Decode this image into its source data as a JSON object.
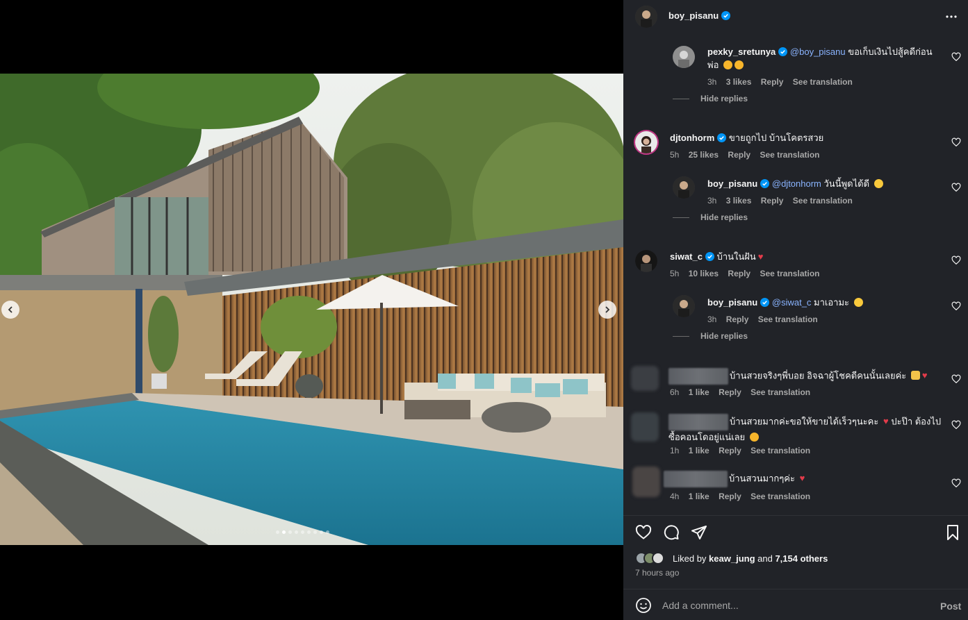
{
  "post": {
    "author": "boy_pisanu",
    "more_icon": "more-horizontal-icon",
    "carousel": {
      "slide_count": 9,
      "active_index": 1
    }
  },
  "comments": [
    {
      "user": "pexky_sretunya",
      "verified": true,
      "mention": "@boy_pisanu",
      "text": " ขอเก็บเงินไปสู้คดีก่อน พ่อ",
      "emoji": [
        "star-eyes",
        "star-eyes"
      ],
      "time": "3h",
      "likes": "3 likes",
      "reply": "Reply",
      "translate": "See translation",
      "hide_replies": "Hide replies"
    },
    {
      "user": "djtonhorm",
      "verified": true,
      "text": " ขายถูกไป บ้านโคตรสวย",
      "time": "5h",
      "likes": "25 likes",
      "reply": "Reply",
      "translate": "See translation"
    },
    {
      "user": "boy_pisanu",
      "verified": true,
      "mention": "@djtonhorm",
      "text": " วันนี้พูดได้ดี",
      "emoji": [
        "laugh"
      ],
      "time": "3h",
      "likes": "3 likes",
      "reply": "Reply",
      "translate": "See translation",
      "hide_replies": "Hide replies"
    },
    {
      "user": "siwat_c",
      "verified": true,
      "text": " บ้านในฝัน",
      "emoji": [
        "heart"
      ],
      "time": "5h",
      "likes": "10 likes",
      "reply": "Reply",
      "translate": "See translation"
    },
    {
      "user": "boy_pisanu",
      "verified": true,
      "mention": "@siwat_c",
      "text": " มาเอามะ",
      "emoji": [
        "laugh"
      ],
      "time": "3h",
      "reply": "Reply",
      "translate": "See translation",
      "hide_replies": "Hide replies"
    },
    {
      "text": "บ้านสวยจริงๆพี่บอย อิจฉาผู้โชคดีคนนั้นเลยค่ะ",
      "emoji": [
        "clap",
        "heart"
      ],
      "time": "6h",
      "likes": "1 like",
      "reply": "Reply",
      "translate": "See translation"
    },
    {
      "text": "บ้านสวยมากค่ะขอให้ขายได้เร็วๆนะคะ",
      "text2": " ปะป๊า ต้องไปซื้อคอนโดอยู่แน่เลย",
      "emoji": [
        "heart"
      ],
      "emoji2": [
        "star-eyes"
      ],
      "time": "1h",
      "likes": "1 like",
      "reply": "Reply",
      "translate": "See translation"
    },
    {
      "text": "บ้านสวนมากๆค่ะ",
      "emoji": [
        "heart"
      ],
      "time": "4h",
      "likes": "1 like",
      "reply": "Reply",
      "translate": "See translation"
    }
  ],
  "likes_summary": {
    "prefix": "Liked by ",
    "user": "keaw_jung",
    "middle": " and ",
    "others": "7,154 others",
    "time_ago": "7 hours ago"
  },
  "comment_box": {
    "placeholder": "Add a comment...",
    "post_label": "Post"
  },
  "colors": {
    "panel_bg": "#212328",
    "verified": "#0095f6",
    "mention": "#8ab4ff",
    "heart_red": "#e23b4a"
  }
}
